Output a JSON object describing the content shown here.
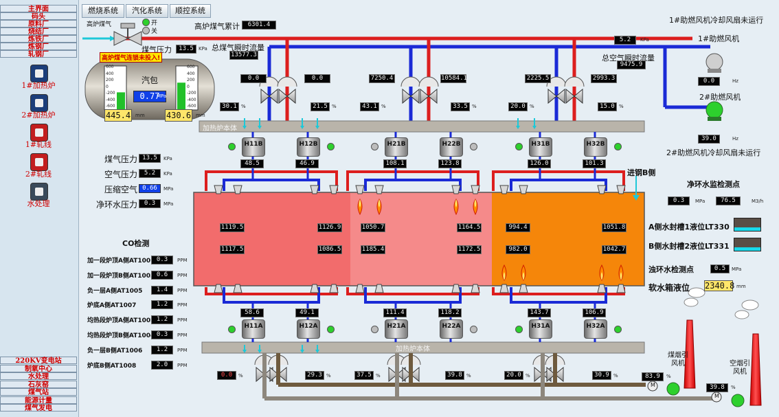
{
  "nav": {
    "top_items": [
      "主界面",
      "码头",
      "原料厂",
      "烧结厂",
      "炼铁厂",
      "炼钢厂",
      "轧钢厂"
    ],
    "icon_items": [
      "1#加热炉",
      "2#加热炉",
      "1#轧线",
      "2#轧线",
      "水处理"
    ],
    "bottom_items": [
      "220KV变电站",
      "制氧中心",
      "水处理",
      "石灰窑",
      "煤气站",
      "能源计量",
      "煤气发电"
    ]
  },
  "tabs": [
    "燃烧系统",
    "汽化系统",
    "顺控系统"
  ],
  "gas": {
    "label": "高炉煤气",
    "open_label": "开",
    "close_label": "关",
    "total_label": "高炉煤气累计",
    "total_value": "6301.4",
    "pressure_label": "煤气压力",
    "pressure_value": "13.5",
    "pressure_unit": "KPa",
    "flow_label": "总煤气瞬时流量",
    "flow_value": "13577.3",
    "interlock_warning": "高炉煤气连锁未投入!"
  },
  "drum": {
    "label": "汽包",
    "pressure_value": "0.77",
    "pressure_unit": "MPa",
    "left_level": "445.4",
    "right_level": "430.6",
    "level_unit": "mm",
    "scale": [
      "600",
      "400",
      "200",
      "0",
      "-200",
      "-400",
      "-600"
    ],
    "left_fill_pct": 40,
    "right_fill_pct": 62
  },
  "air": {
    "pressure_value": "5.2",
    "pressure_unit": "KPa",
    "flow_label": "总空气瞬时流量",
    "flow_value": "9475.9",
    "fan1_status": "1#助燃风机冷却风扇未运行",
    "fan1_label": "1#助燃风机",
    "fan1_value": "0.0",
    "fan2_status": "2#助燃风机冷却风扇未运行",
    "fan2_label": "2#助燃风机",
    "fan2_value": "39.0",
    "hz_unit": "Hz"
  },
  "top_valves": {
    "flows": [
      "0.0",
      "0.0",
      "7250.4",
      "10584.1",
      "2225.5",
      "2993.3"
    ],
    "openings": [
      "30.1",
      "21.5",
      "43.1",
      "33.5",
      "20.0",
      "15.0"
    ]
  },
  "header_label": "加热炉本体",
  "top_burners": {
    "names": [
      "H11B",
      "H12B",
      "H21B",
      "H22B",
      "H31B",
      "H32B"
    ],
    "values": [
      "48.5",
      "46.9",
      "108.1",
      "123.8",
      "126.0",
      "101.3"
    ]
  },
  "side_params": [
    {
      "label": "煤气压力",
      "value": "13.5",
      "unit": "KPa"
    },
    {
      "label": "空气压力",
      "value": "5.2",
      "unit": "KPa"
    },
    {
      "label": "压缩空气",
      "value": "0.66",
      "unit": "MPa"
    },
    {
      "label": "净环水压力",
      "value": "0.3",
      "unit": "MPa"
    }
  ],
  "entry_label": "进钢B侧",
  "zones": [
    {
      "top_left": "1119.5",
      "top_right": "1126.9",
      "bot_left": "1117.5",
      "bot_right": "1086.5"
    },
    {
      "top_left": "1050.7",
      "top_right": "1164.5",
      "bot_left": "1185.4",
      "bot_right": "1172.5"
    },
    {
      "top_left": "994.4",
      "top_right": "1051.8",
      "bot_left": "982.0",
      "bot_right": "1042.7"
    }
  ],
  "co": {
    "title": "CO检测",
    "items": [
      {
        "label": "加一段炉顶A侧AT1001",
        "value": "0.3",
        "unit": "PPM"
      },
      {
        "label": "加一段炉顶B侧AT1003",
        "value": "0.6",
        "unit": "PPM"
      },
      {
        "label": "负一层A侧AT1005",
        "value": "1.4",
        "unit": "PPM"
      },
      {
        "label": "炉底A侧AT1007",
        "value": "1.2",
        "unit": "PPM"
      },
      {
        "label": "均热段炉顶A侧AT1002",
        "value": "1.2",
        "unit": "PPM"
      },
      {
        "label": "均热段炉顶B侧AT1004",
        "value": "0.3",
        "unit": "PPM"
      },
      {
        "label": "负一层B侧AT1006",
        "value": "1.2",
        "unit": "PPM"
      },
      {
        "label": "炉底B侧AT1008",
        "value": "2.0",
        "unit": "PPM"
      }
    ]
  },
  "water": {
    "title": "净环水监检测点",
    "pressure_value": "0.3",
    "pressure_unit": "MPa",
    "flow_value": "76.5",
    "flow_unit": "M3/h",
    "tank_a_label": "A侧水封槽1液位LT330",
    "tank_b_label": "B侧水封槽2液位LT331",
    "dirty_label": "浊环水检测点",
    "dirty_value": "0.5",
    "dirty_unit": "MPa",
    "soft_label": "软水箱液位",
    "soft_value": "2340.8",
    "soft_unit": "mm"
  },
  "bottom_burners": {
    "names": [
      "H11A",
      "H12A",
      "H21A",
      "H22A",
      "H31A",
      "H32A"
    ],
    "values": [
      "58.6",
      "49.1",
      "111.4",
      "118.2",
      "143.7",
      "106.9"
    ]
  },
  "bottom_valves": {
    "openings": [
      "0.0",
      "29.3",
      "37.5",
      "39.8",
      "20.0",
      "30.9"
    ]
  },
  "exhaust": {
    "gas_fan_label": "煤烟引风机",
    "gas_fan_value": "83.9",
    "air_fan_label": "空烟引风机",
    "air_fan_value": "39.8",
    "motor_label": "M"
  },
  "pct_unit": "%",
  "colors": {
    "gas_pipe": "#dc1e1e",
    "air_pipe": "#1a2ad6",
    "zone1": "#f26c6c",
    "zone2": "#f58a8a",
    "zone3": "#f5860a"
  }
}
